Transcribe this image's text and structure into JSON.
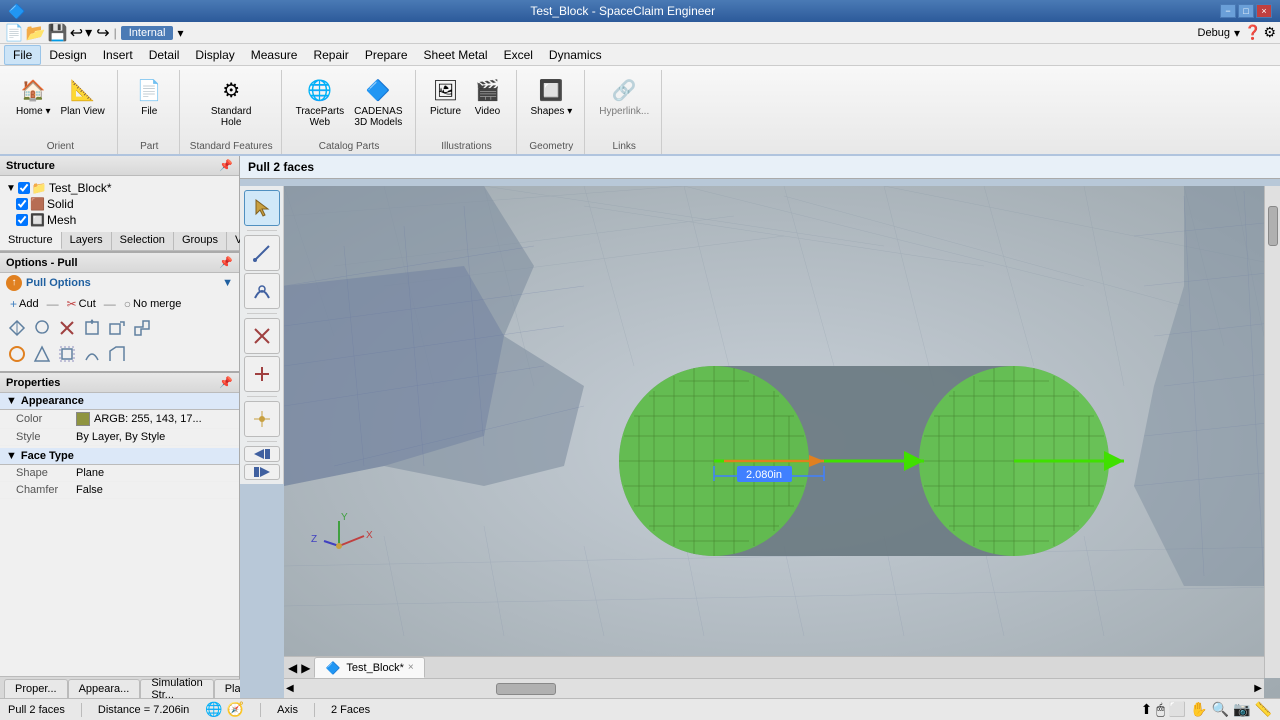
{
  "titlebar": {
    "title": "Test_Block - SpaceClaim Engineer",
    "minimize": "−",
    "maximize": "□",
    "close": "×"
  },
  "menubar": {
    "items": [
      "File",
      "Design",
      "Insert",
      "Detail",
      "Display",
      "Measure",
      "Repair",
      "Prepare",
      "Sheet Metal",
      "Excel",
      "Dynamics"
    ]
  },
  "quickaccess": {
    "tag": "Internal",
    "debug_label": "Debug"
  },
  "ribbon": {
    "groups": [
      {
        "label": "Orient",
        "buttons": [
          {
            "icon": "🏠",
            "label": "Home"
          },
          {
            "icon": "📐",
            "label": "Plan View"
          }
        ]
      },
      {
        "label": "Part",
        "buttons": [
          {
            "icon": "📄",
            "label": "File"
          }
        ]
      },
      {
        "label": "Standard Features",
        "buttons": [
          {
            "icon": "⚙",
            "label": "Standard\nHole"
          }
        ]
      },
      {
        "label": "Catalog Parts",
        "buttons": [
          {
            "icon": "🌐",
            "label": "TraceParts\nWeb"
          },
          {
            "icon": "🔷",
            "label": "CADENAS\n3D Models"
          }
        ]
      },
      {
        "label": "Illustrations",
        "buttons": [
          {
            "icon": "🖼",
            "label": "Picture"
          },
          {
            "icon": "🎬",
            "label": "Video"
          }
        ]
      },
      {
        "label": "Geometry",
        "buttons": [
          {
            "icon": "🔲",
            "label": "Shapes"
          }
        ]
      },
      {
        "label": "Links",
        "buttons": [
          {
            "icon": "🔗",
            "label": "Hyperlink..."
          }
        ]
      }
    ]
  },
  "structure": {
    "panel_title": "Structure",
    "tree": [
      {
        "label": "Test_Block*",
        "icon": "▼",
        "type": "root",
        "checked": true
      },
      {
        "label": "Solid",
        "icon": "🟫",
        "type": "solid",
        "checked": true,
        "indent": 1
      },
      {
        "label": "Mesh",
        "icon": "🔲",
        "type": "mesh",
        "checked": true,
        "indent": 1
      }
    ],
    "tabs": [
      "Structure",
      "Layers",
      "Selection",
      "Groups",
      "Views"
    ]
  },
  "options_pull": {
    "panel_title": "Options - Pull",
    "section_title": "Pull Options",
    "collapse_icon": "▼",
    "options": [
      "Add",
      "Cut",
      "No merge"
    ],
    "tools_row1": [
      "arrow",
      "star",
      "x",
      "cube",
      "box",
      "grid"
    ],
    "tools_row2": [
      "circle",
      "square",
      "rect",
      "cylinder",
      "sphere"
    ]
  },
  "properties": {
    "panel_title": "Properties",
    "appearance_section": "Appearance",
    "appearance_props": [
      {
        "label": "Color",
        "value": "ARGB: 255, 143, 17...",
        "has_swatch": true,
        "swatch_color": "#8f9440"
      },
      {
        "label": "Style",
        "value": "By Layer, By Style"
      }
    ],
    "face_type_section": "Face Type",
    "face_type_props": [
      {
        "label": "Shape",
        "value": "Plane"
      },
      {
        "label": "Chamfer",
        "value": "False"
      }
    ]
  },
  "viewport": {
    "header": "Pull 2 faces",
    "dimension_label": "2.080in",
    "axis_label": "Axis"
  },
  "tabs_bottom": [
    {
      "label": "Proper...",
      "active": false
    },
    {
      "label": "Appeara...",
      "active": false
    },
    {
      "label": "Simulation Str...",
      "active": false
    },
    {
      "label": "Playb...",
      "active": false
    }
  ],
  "tabbar_doc": {
    "label": "Test_Block*",
    "close": "×"
  },
  "statusbar": {
    "left_label": "Pull 2 faces",
    "distance": "Distance = 7.206in",
    "axis": "Axis",
    "faces": "2 Faces"
  }
}
